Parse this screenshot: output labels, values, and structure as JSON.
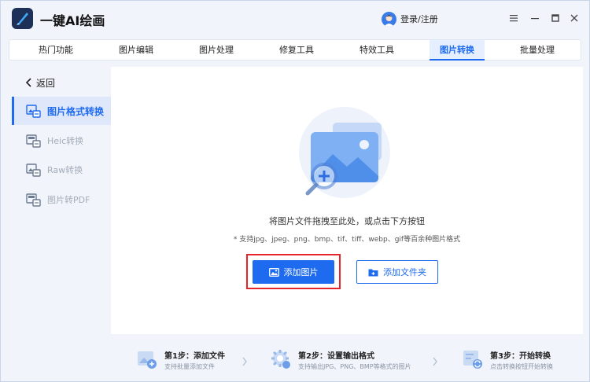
{
  "app": {
    "title": "一键AI绘画",
    "login_label": "登录/注册"
  },
  "window_controls": [
    "menu-icon",
    "minimize-icon",
    "maximize-icon",
    "close-icon"
  ],
  "tabs": [
    {
      "label": "热门功能",
      "active": false
    },
    {
      "label": "图片编辑",
      "active": false
    },
    {
      "label": "图片处理",
      "active": false
    },
    {
      "label": "修复工具",
      "active": false
    },
    {
      "label": "特效工具",
      "active": false
    },
    {
      "label": "图片转换",
      "active": true
    },
    {
      "label": "批量处理",
      "active": false
    }
  ],
  "sidebar": {
    "back_label": "返回",
    "items": [
      {
        "label": "图片格式转换",
        "active": true
      },
      {
        "label": "Heic转换",
        "active": false
      },
      {
        "label": "Raw转换",
        "active": false
      },
      {
        "label": "图片转PDF",
        "active": false
      }
    ]
  },
  "main": {
    "drop_hint": "将图片文件拖拽至此处，或点击下方按钮",
    "formats": "* 支持jpg、jpeg、png、bmp、tif、tiff、webp、gif等百余种图片格式",
    "add_image_label": "添加图片",
    "add_folder_label": "添加文件夹"
  },
  "steps": [
    {
      "title": "第1步：添加文件",
      "desc": "支持批量添加文件"
    },
    {
      "title": "第2步：设置输出格式",
      "desc": "支持输出JPG、PNG、BMP等格式的图片"
    },
    {
      "title": "第3步：开始转换",
      "desc": "点击转换按钮开始转换"
    }
  ],
  "colors": {
    "accent": "#1f6bf0",
    "highlight": "#e4262c",
    "background": "#f1f5fb"
  }
}
